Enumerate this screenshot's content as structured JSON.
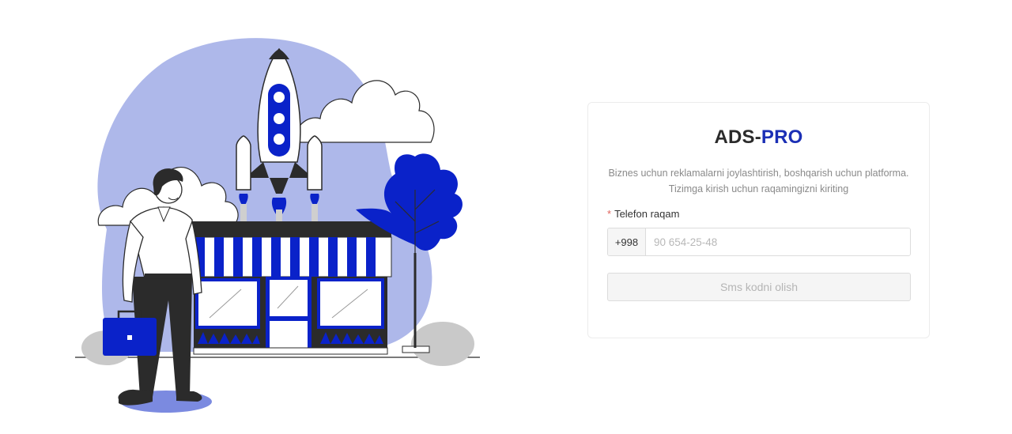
{
  "brand": {
    "prefix": "ADS-",
    "accent": "PRO"
  },
  "description": {
    "line1": "Biznes uchun reklamalarni joylashtirish, boshqarish uchun platforma.",
    "line2": "Tizimga kirish uchun raqamingizni kiriting"
  },
  "form": {
    "required_mark": "*",
    "phone_label": "Telefon raqam",
    "phone_prefix": "+998",
    "phone_placeholder": "90 654-25-48",
    "phone_value": "",
    "submit_label": "Sms kodni olish"
  },
  "illustration": {
    "icon": "startup-shop-rocket-illustration"
  },
  "colors": {
    "accent": "#1b2fb5",
    "illustration_blob": "#aeb8ea",
    "illustration_blue": "#0a22c9",
    "muted_text": "#8a8a8a",
    "required": "#e0625b"
  }
}
